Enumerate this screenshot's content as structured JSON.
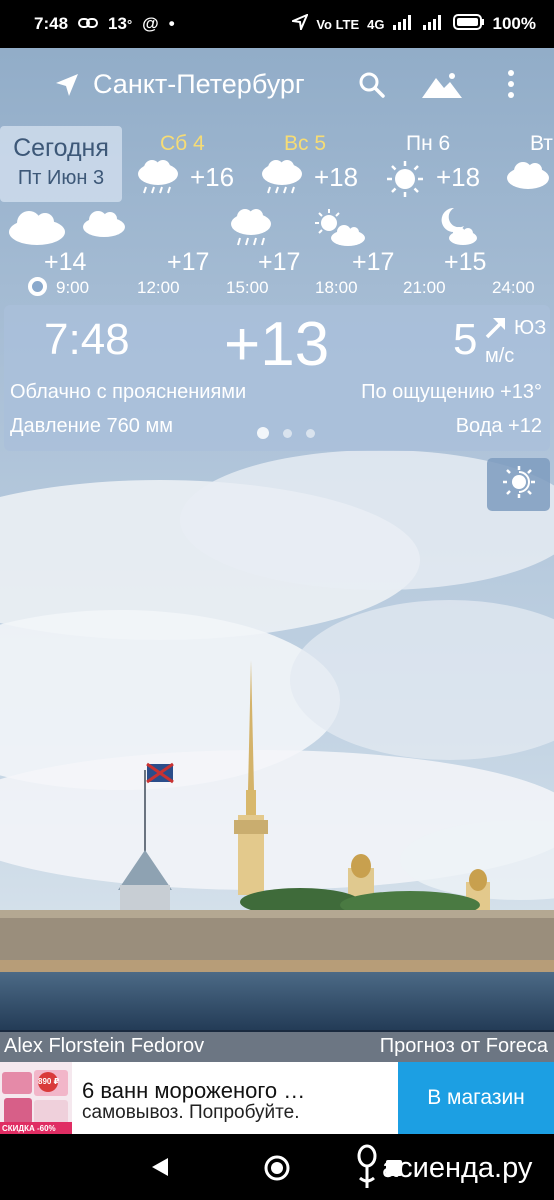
{
  "status_bar": {
    "time": "7:48",
    "temp_badge": "13",
    "degree_mark": "°",
    "at_symbol": "@",
    "dot": "•",
    "network": "4G",
    "volte": "Vo LTE",
    "battery": "100%"
  },
  "toolbar": {
    "city": "Санкт-Петербург"
  },
  "days": {
    "today_label": "Сегодня",
    "today_date": "Пт Июн 3",
    "items": [
      {
        "name": "Сб 4",
        "temp": "+16",
        "icon": "rain-cloud-icon",
        "weekend": true
      },
      {
        "name": "Вс 5",
        "temp": "+18",
        "icon": "rain-cloud-icon",
        "weekend": true
      },
      {
        "name": "Пн 6",
        "temp": "+18",
        "icon": "sun-icon",
        "weekend": false
      },
      {
        "name": "Вт",
        "temp": "",
        "icon": "cloud-icon",
        "weekend": false
      }
    ]
  },
  "hourly": [
    {
      "time": "9:00",
      "temp": "+14",
      "icon": "cloud-icon"
    },
    {
      "time": "12:00",
      "temp": "+17",
      "icon": "cloud-icon"
    },
    {
      "time": "15:00",
      "temp": "+17",
      "icon": "rain-cloud-icon"
    },
    {
      "time": "18:00",
      "temp": "+17",
      "icon": "sun-cloud-icon"
    },
    {
      "time": "21:00",
      "temp": "+15",
      "icon": "moon-cloud-icon"
    },
    {
      "time": "24:00",
      "temp": "",
      "icon": ""
    }
  ],
  "current": {
    "time": "7:48",
    "temp": "+13",
    "wind_speed": "5",
    "wind_unit": "м/с",
    "wind_dir": "ЮЗ",
    "condition": "Облачно с прояснениями",
    "feels_like": "По ощущению +13°",
    "pressure": "Давление 760 мм",
    "water": "Вода +12",
    "page_index": 1,
    "page_count": 3
  },
  "credits": {
    "author": "Alex Florstein Fedorov",
    "provider": "Прогноз от Foreca"
  },
  "ad": {
    "title": "6 ванн мороженого …",
    "subtitle": "самовывоз. Попробуйте.",
    "button": "В магазин",
    "thumb_price": "890 ₽",
    "thumb_badge": "СКИДКА -60%"
  },
  "watermark": {
    "text": "асиенда.ру"
  },
  "colors": {
    "accent": "#1c9fe3",
    "weekend": "#f6dc75",
    "today_text": "#3d5878"
  }
}
